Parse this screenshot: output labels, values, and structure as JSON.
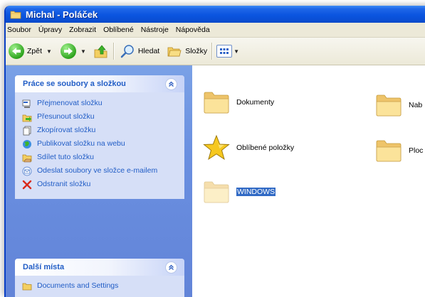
{
  "window": {
    "title": "Michal - Poláček"
  },
  "menu": [
    "Soubor",
    "Úpravy",
    "Zobrazit",
    "Oblíbené",
    "Nástroje",
    "Nápověda"
  ],
  "toolbar": {
    "back": "Zpět",
    "search": "Hledat",
    "folders": "Složky"
  },
  "taskpane": {
    "panels": [
      {
        "title": "Práce se soubory a složkou",
        "items": [
          "Přejmenovat složku",
          "Přesunout složku",
          "Zkopírovat složku",
          "Publikovat složku na webu",
          "Sdílet tuto složku",
          "Odeslat soubory ve složce e-mailem",
          "Odstranit složku"
        ]
      },
      {
        "title": "Další místa",
        "items": [
          "Documents and Settings"
        ]
      }
    ]
  },
  "files": [
    {
      "name": "Dokumenty",
      "icon": "folder-icon"
    },
    {
      "name": "Oblíbené položky",
      "icon": "star-icon"
    },
    {
      "name": "WINDOWS",
      "icon": "folder-icon",
      "selected": true
    },
    {
      "name": "Nab",
      "icon": "folder-icon"
    },
    {
      "name": "Ploc",
      "icon": "folder-icon"
    }
  ],
  "colors": {
    "title_bar": "#0b55e0",
    "task_link": "#215dc6",
    "selection": "#316ac5"
  }
}
